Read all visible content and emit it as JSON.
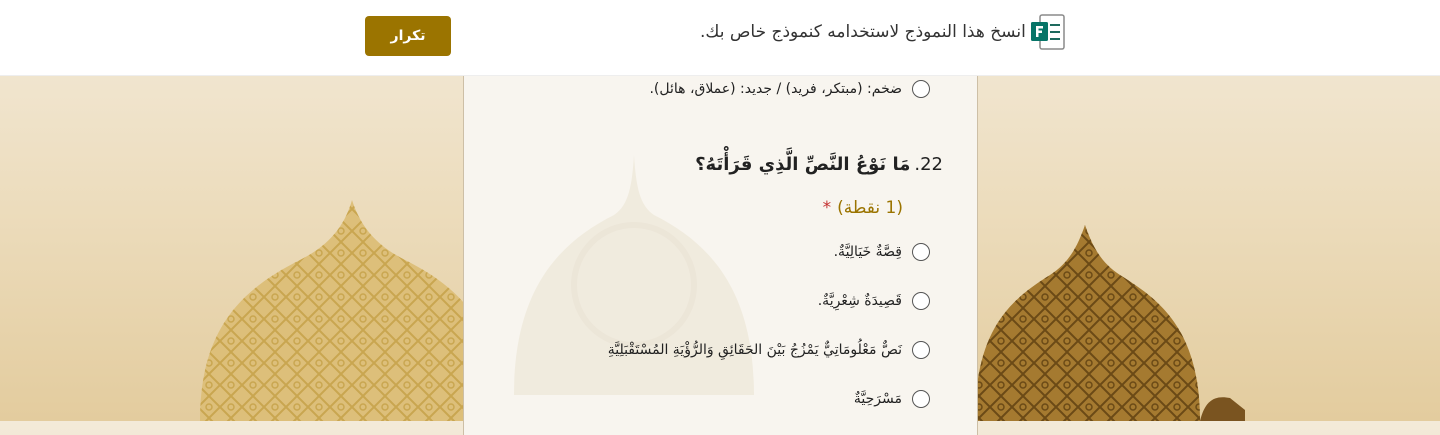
{
  "banner": {
    "copy_text": "انسخ هذا النموذج لاستخدامه كنموذج خاص بك.",
    "repeat_label": "تكرار",
    "icon": "microsoft-forms-icon"
  },
  "form": {
    "prev_option": "ضخم: (مبتكر، فريد) / جديد: (عملاق، هائل).",
    "question": {
      "number": "22.",
      "text": "مَا نَوْعُ النَّصِّ الَّذِي قَرَأْتَهُ؟",
      "points": "(1 نقطة)",
      "required_mark": "*",
      "options": [
        "قِصَّةٌ خَيَالِيَّةٌ.",
        "قَصِيدَةٌ شِعْرِيَّةٌ.",
        "نَصٌّ مَعْلُومَاتِيٌّ يَمْزُجُ بَيْنَ الحَقَائِقِ وَالرُّؤْيَةِ المُسْتَقْبَلِيَّةِ",
        "مَسْرَحِيَّةٌ"
      ]
    }
  },
  "colors": {
    "accent": "#9b7400",
    "required": "#c43131",
    "panel": "#f8f5ef",
    "background": "#ecdcbc"
  }
}
